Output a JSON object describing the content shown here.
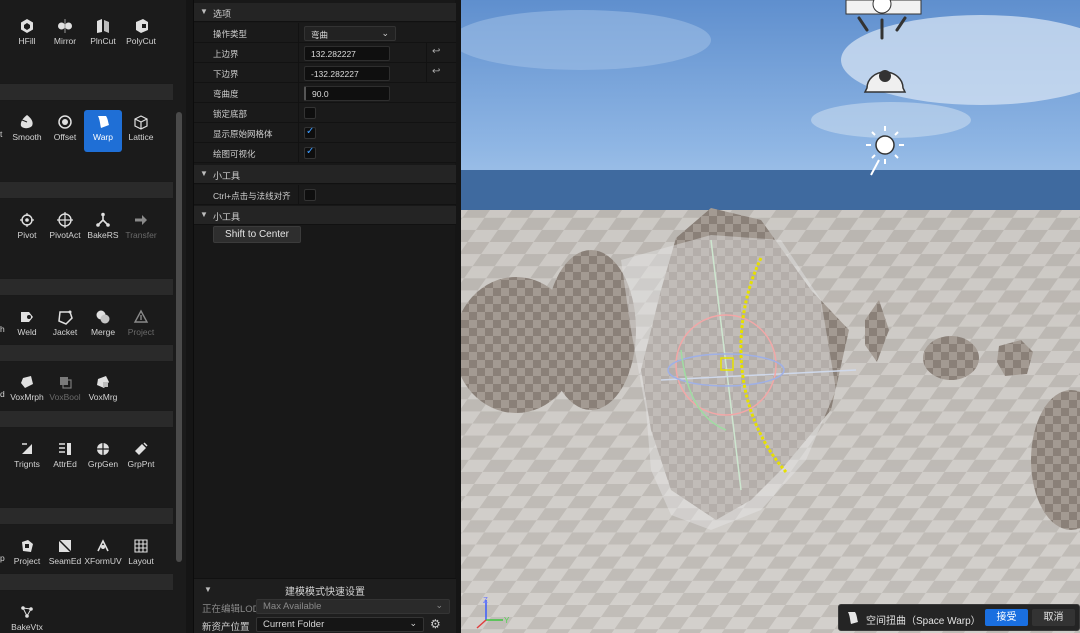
{
  "palette": {
    "row1": [
      "HFill",
      "Mirror",
      "PlnCut",
      "PolyCut"
    ],
    "row2_cut": "t",
    "row2": [
      "Smooth",
      "Offset",
      "Warp",
      "Lattice"
    ],
    "row3": [
      "Pivot",
      "PivotAct",
      "BakeRS",
      "Transfer"
    ],
    "row4_cut": "h",
    "row4": [
      "Weld",
      "Jacket",
      "Merge",
      "Project"
    ],
    "row5_cut": "d",
    "row5": [
      "VoxMrph",
      "VoxBool",
      "VoxMrg"
    ],
    "row6": [
      "Trignts",
      "AttrEd",
      "GrpGen",
      "GrpPnt"
    ],
    "row7_cut": "p",
    "row7": [
      "Project",
      "SeamEd",
      "XFormUV",
      "Layout"
    ],
    "row8": [
      "BakeVtx"
    ],
    "active_tool": "Warp"
  },
  "properties": {
    "options_header": "选项",
    "operation_type_label": "操作类型",
    "operation_type_value": "弯曲",
    "upper_bound_label": "上边界",
    "upper_bound_value": "132.282227",
    "lower_bound_label": "下边界",
    "lower_bound_value": "-132.282227",
    "bend_degrees_label": "弯曲度",
    "bend_degrees_value": "90.0",
    "lock_bottom_label": "锁定底部",
    "lock_bottom_checked": false,
    "show_original_label": "显示原始网格体",
    "show_original_checked": true,
    "draw_visualization_label": "绘图可视化",
    "draw_visualization_checked": true,
    "gizmo_header_1": "小工具",
    "ctrl_click_label": "Ctrl+点击与法线对齐",
    "ctrl_click_checked": false,
    "gizmo_header_2": "小工具",
    "shift_to_center_label": "Shift to Center"
  },
  "quick_settings": {
    "header": "建模模式快速设置",
    "lod_label": "正在编辑LOD",
    "lod_value": "Max Available",
    "asset_location_label": "新资产位置",
    "asset_location_value": "Current Folder"
  },
  "notification": {
    "text": "空间扭曲（Space Warp）",
    "accept_label": "接受",
    "cancel_label": "取消"
  },
  "colors": {
    "accent": "#1f6fd6",
    "checkbox_mark": "#3d9bff",
    "accept_button": "#1a6fe0"
  }
}
